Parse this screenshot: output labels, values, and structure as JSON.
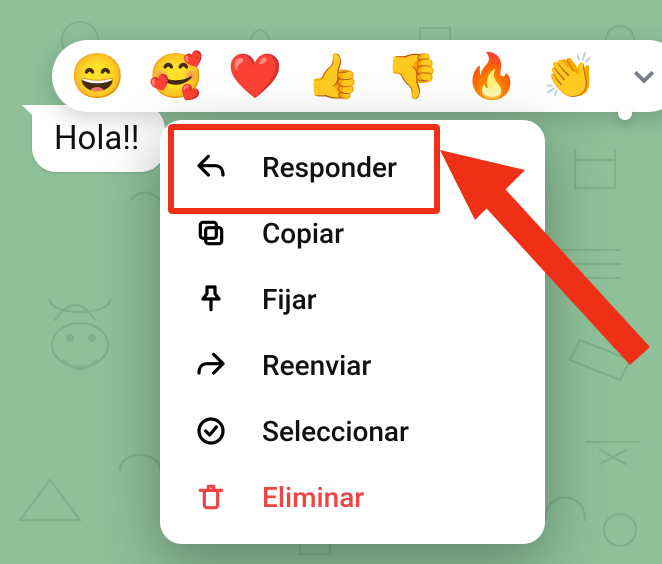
{
  "message": {
    "text": "Hola!!"
  },
  "reactions": {
    "emojis": [
      "😄",
      "🥰",
      "❤️",
      "👍",
      "👎",
      "🔥",
      "👏"
    ]
  },
  "menu": {
    "items": [
      {
        "key": "reply",
        "label": "Responder",
        "danger": false
      },
      {
        "key": "copy",
        "label": "Copiar",
        "danger": false
      },
      {
        "key": "pin",
        "label": "Fijar",
        "danger": false
      },
      {
        "key": "forward",
        "label": "Reenviar",
        "danger": false
      },
      {
        "key": "select",
        "label": "Seleccionar",
        "danger": false
      },
      {
        "key": "delete",
        "label": "Eliminar",
        "danger": true
      }
    ]
  },
  "annotation": {
    "highlighted_item": "reply"
  },
  "colors": {
    "accent": "#ef3016",
    "danger": "#ef4444",
    "bg": "#8ec09a"
  }
}
